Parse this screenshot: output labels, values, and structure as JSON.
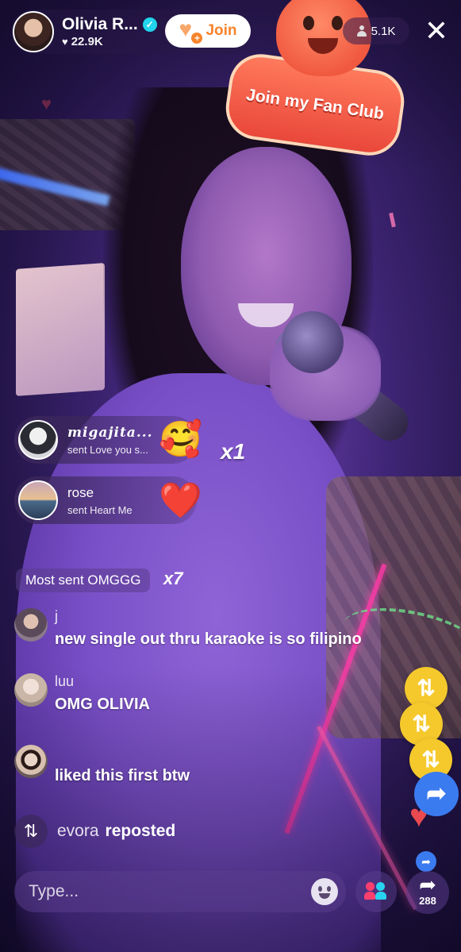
{
  "host": {
    "name": "Olivia R...",
    "likes": "22.9K",
    "join_label": "Join"
  },
  "fan_club": {
    "label": "Join my Fan Club"
  },
  "viewers": "5.1K",
  "gifts": [
    {
      "user": "migajita...",
      "text": "sent Love you s...",
      "combo": "x1",
      "gift_icon": "love-you-bear-icon"
    },
    {
      "user": "rose",
      "text": "sent Heart Me",
      "combo": "",
      "gift_icon": "heart-me-icon"
    }
  ],
  "most_sent": {
    "label": "Most sent OMGGG",
    "combo": "x7"
  },
  "comments": [
    {
      "user": "j",
      "text": "new single out thru karaoke is so filipino"
    },
    {
      "user": "luu",
      "text": "OMG OLIVIA"
    },
    {
      "user": "",
      "text": "liked this first btw"
    }
  ],
  "repost": {
    "user": "evora",
    "action": "reposted"
  },
  "input": {
    "placeholder": "Type..."
  },
  "share": {
    "count": "288"
  },
  "colors": {
    "join_orange": "#f7842b",
    "repost_yellow": "#f5c92c",
    "share_blue": "#3b7bf0",
    "verified": "#20d5ec"
  }
}
